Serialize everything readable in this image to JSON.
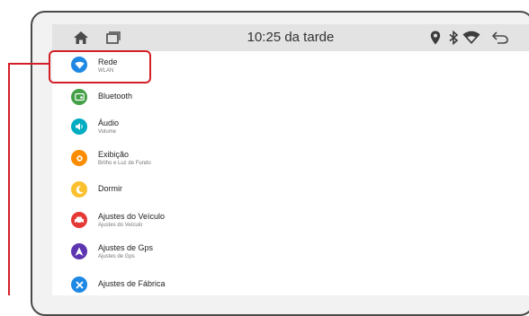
{
  "statusbar": {
    "time": "10:25 da tarde",
    "icons": [
      "home-icon",
      "recent-apps-icon",
      "location-icon",
      "bluetooth-icon",
      "wifi-icon",
      "back-icon"
    ]
  },
  "settings": {
    "items": [
      {
        "title": "Rede",
        "subtitle": "WLAN",
        "icon": "wifi-icon",
        "color": "#1e88e5"
      },
      {
        "title": "Bluetooth",
        "subtitle": "",
        "icon": "bluetooth-icon",
        "color": "#43a047"
      },
      {
        "title": "Áudio",
        "subtitle": "Volume",
        "icon": "volume-icon",
        "color": "#00acc1"
      },
      {
        "title": "Exibição",
        "subtitle": "Brilho e Luz de Fundo",
        "icon": "brightness-icon",
        "color": "#fb8c00"
      },
      {
        "title": "Dormir",
        "subtitle": "",
        "icon": "moon-icon",
        "color": "#fbc02d"
      },
      {
        "title": "Ajustes do Veículo",
        "subtitle": "Ajustes do Veículo",
        "icon": "car-icon",
        "color": "#e53935"
      },
      {
        "title": "Ajustes de Gps",
        "subtitle": "Ajustes de Gps",
        "icon": "navigation-icon",
        "color": "#5e35b1"
      },
      {
        "title": "Ajustes de Fábrica",
        "subtitle": "",
        "icon": "tools-icon",
        "color": "#1e88e5"
      }
    ]
  },
  "colors": {
    "highlight": "#d32027",
    "statusbar": "#e3e3e3"
  }
}
